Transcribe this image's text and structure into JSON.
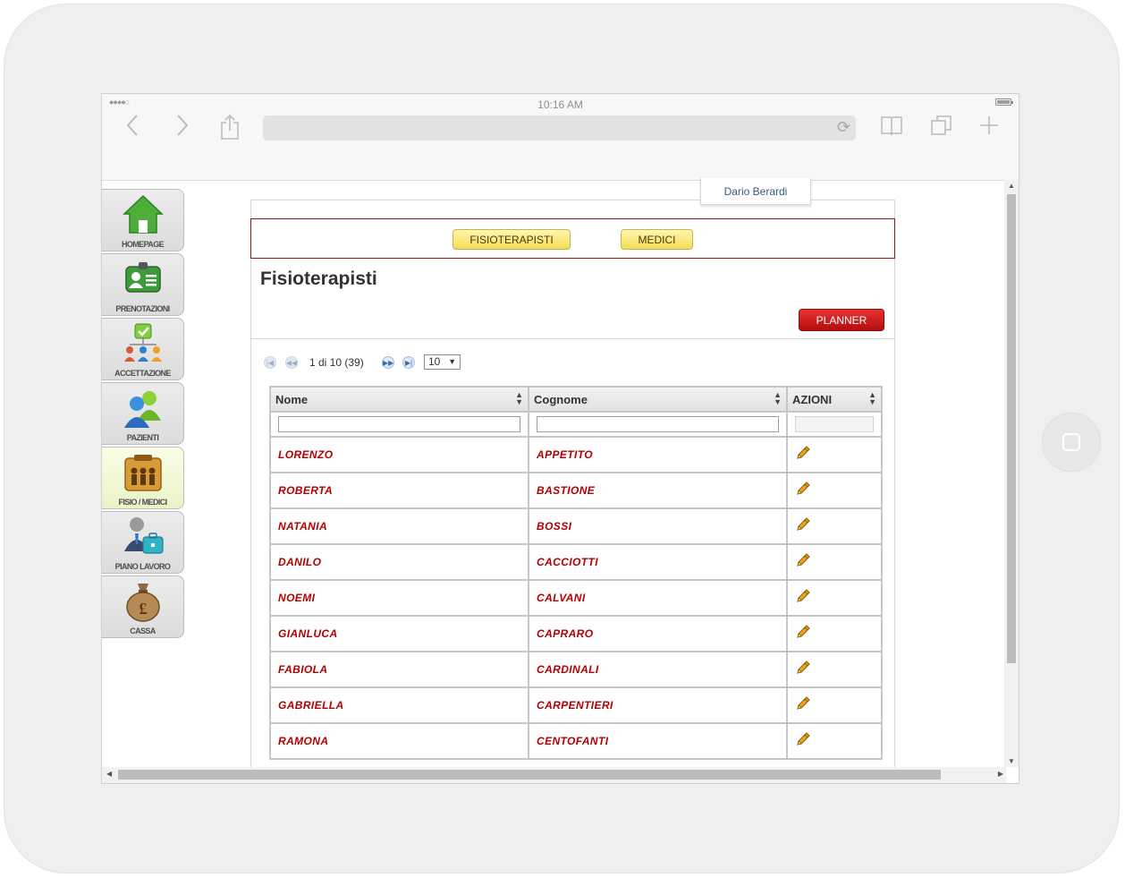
{
  "browser": {
    "time": "10:16 AM",
    "signal_dots": "●●●●○"
  },
  "user": {
    "name": "Dario Berardi"
  },
  "sidebar": {
    "items": [
      {
        "label": "HOMEPAGE",
        "icon": "home-icon"
      },
      {
        "label": "PRENOTAZIONI",
        "icon": "id-card-icon"
      },
      {
        "label": "ACCETTAZIONE",
        "icon": "org-chart-icon"
      },
      {
        "label": "PAZIENTI",
        "icon": "users-icon"
      },
      {
        "label": "FISIO / MEDICI",
        "icon": "staff-board-icon",
        "active": true
      },
      {
        "label": "PIANO LAVORO",
        "icon": "briefcase-user-icon"
      },
      {
        "label": "CASSA",
        "icon": "money-bag-icon"
      }
    ]
  },
  "tabs": {
    "fisioterapisti": "FISIOTERAPISTI",
    "medici": "MEDICI"
  },
  "page": {
    "title": "Fisioterapisti",
    "planner_label": "PLANNER"
  },
  "pager": {
    "text": "1 di 10 (39)",
    "page_size": "10"
  },
  "table": {
    "columns": [
      "Nome",
      "Cognome",
      "AZIONI"
    ],
    "rows": [
      {
        "nome": "LORENZO",
        "cognome": "APPETITO"
      },
      {
        "nome": "ROBERTA",
        "cognome": "BASTIONE"
      },
      {
        "nome": "NATANIA",
        "cognome": "BOSSI"
      },
      {
        "nome": "DANILO",
        "cognome": "CACCIOTTI"
      },
      {
        "nome": "NOEMI",
        "cognome": "CALVANI"
      },
      {
        "nome": "GIANLUCA",
        "cognome": "CAPRARO"
      },
      {
        "nome": "FABIOLA",
        "cognome": "CARDINALI"
      },
      {
        "nome": "GABRIELLA",
        "cognome": "CARPENTIERI"
      },
      {
        "nome": "RAMONA",
        "cognome": "CENTOFANTI"
      }
    ]
  },
  "colors": {
    "accent_red": "#b30000",
    "tab_yellow": "#f3dd55",
    "planner_red": "#d01e1e",
    "active_nav": "#eaf3c7"
  }
}
